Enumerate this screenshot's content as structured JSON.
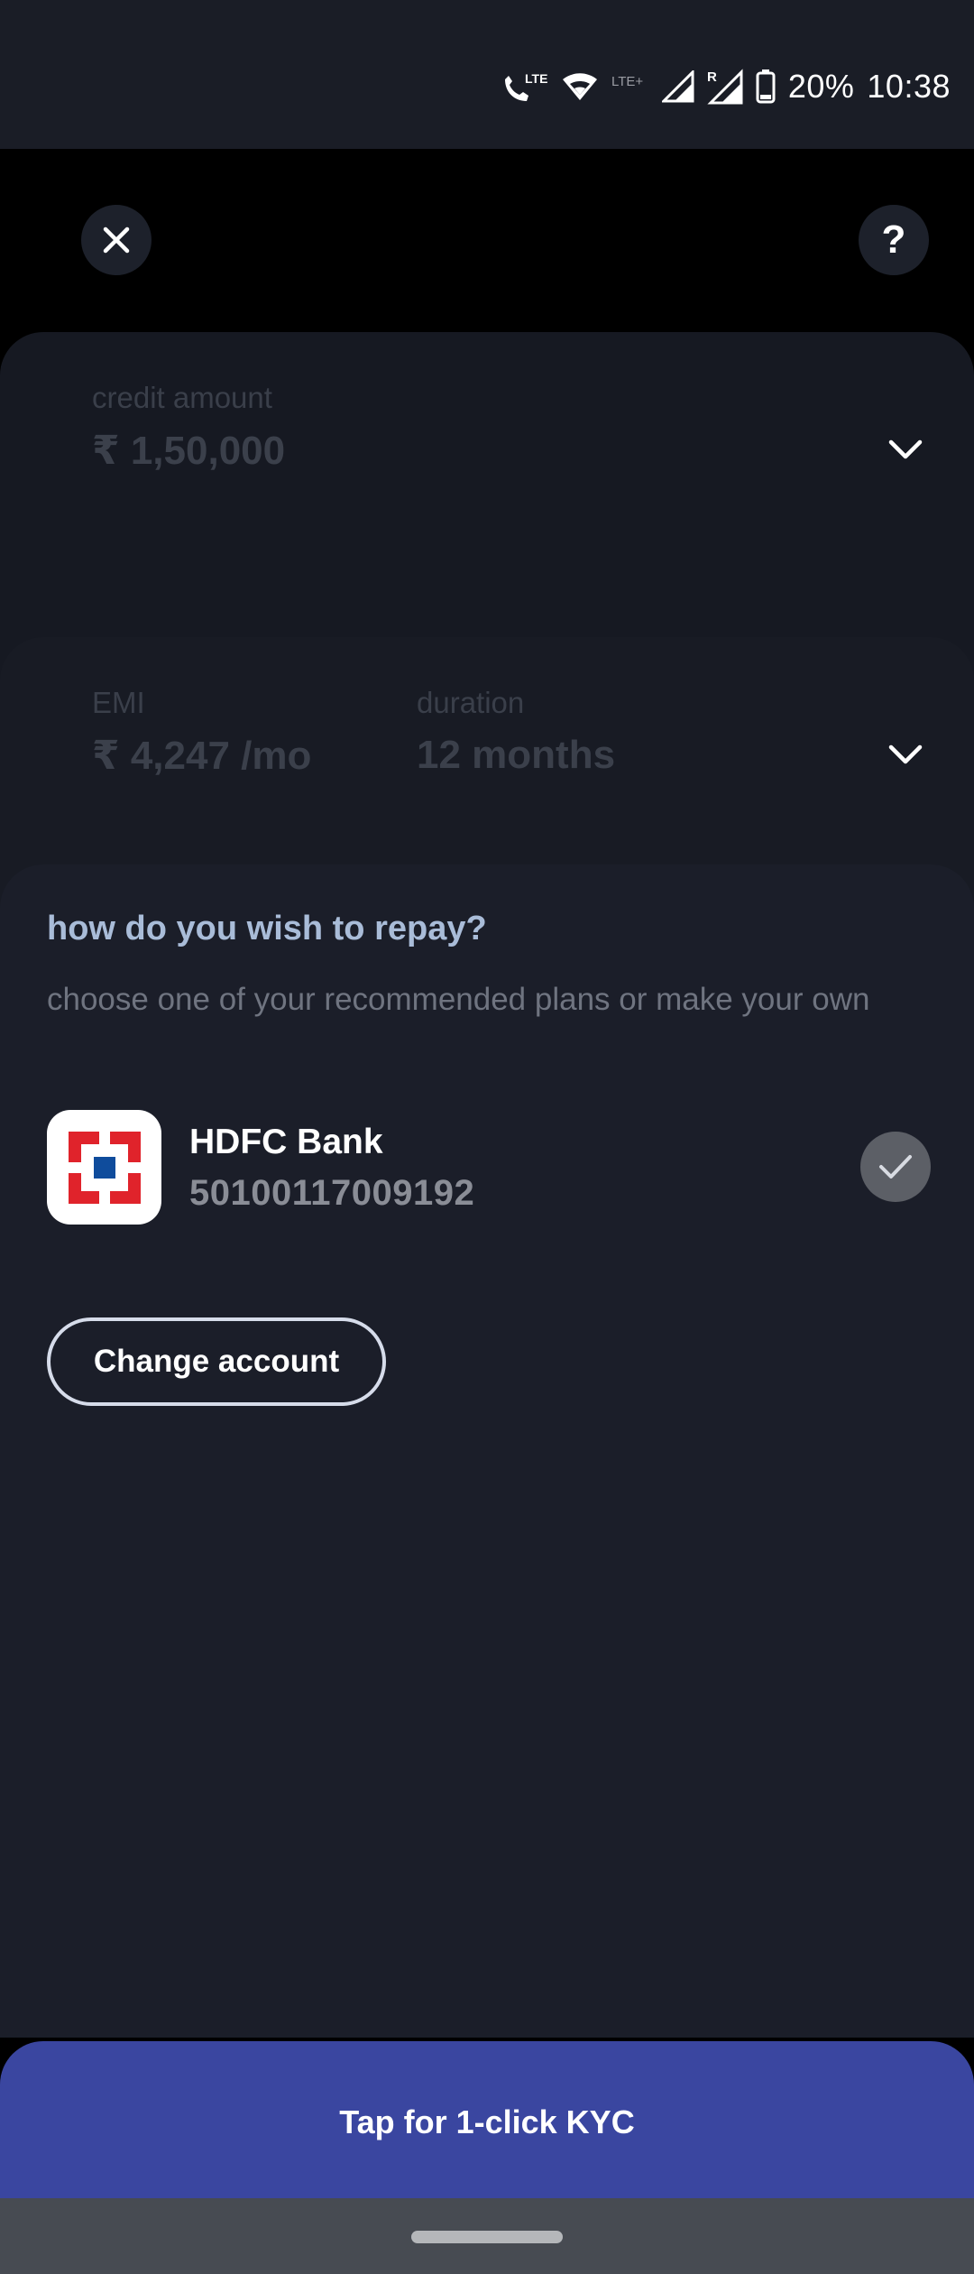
{
  "status_bar": {
    "battery_percent": "20%",
    "time": "10:38",
    "icons": [
      "volte-call-icon",
      "wifi-icon",
      "lte-plus-icon",
      "signal-icon",
      "roaming-signal-icon",
      "battery-icon"
    ],
    "lte_label": "LTE",
    "lte_plus_label": "LTE+",
    "roaming_label": "R"
  },
  "header": {
    "close_icon": "close-icon",
    "help_label": "?"
  },
  "credit_card": {
    "label": "credit amount",
    "value": "₹ 1,50,000"
  },
  "emi_card": {
    "emi_label": "EMI",
    "emi_value": "₹ 4,247 /mo",
    "duration_label": "duration",
    "duration_value": "12 months"
  },
  "repay_sheet": {
    "title": "how do you wish to repay?",
    "subtitle": "choose one of your recommended plans or make your own",
    "bank": {
      "name": "HDFC Bank",
      "account_number": "50100117009192",
      "selected": true,
      "logo_colors": {
        "red": "#e0232b",
        "blue": "#0f4c9c"
      }
    },
    "change_account_label": "Change account"
  },
  "cta": {
    "label": "Tap for 1-click KYC",
    "color": "#3a46a0"
  }
}
